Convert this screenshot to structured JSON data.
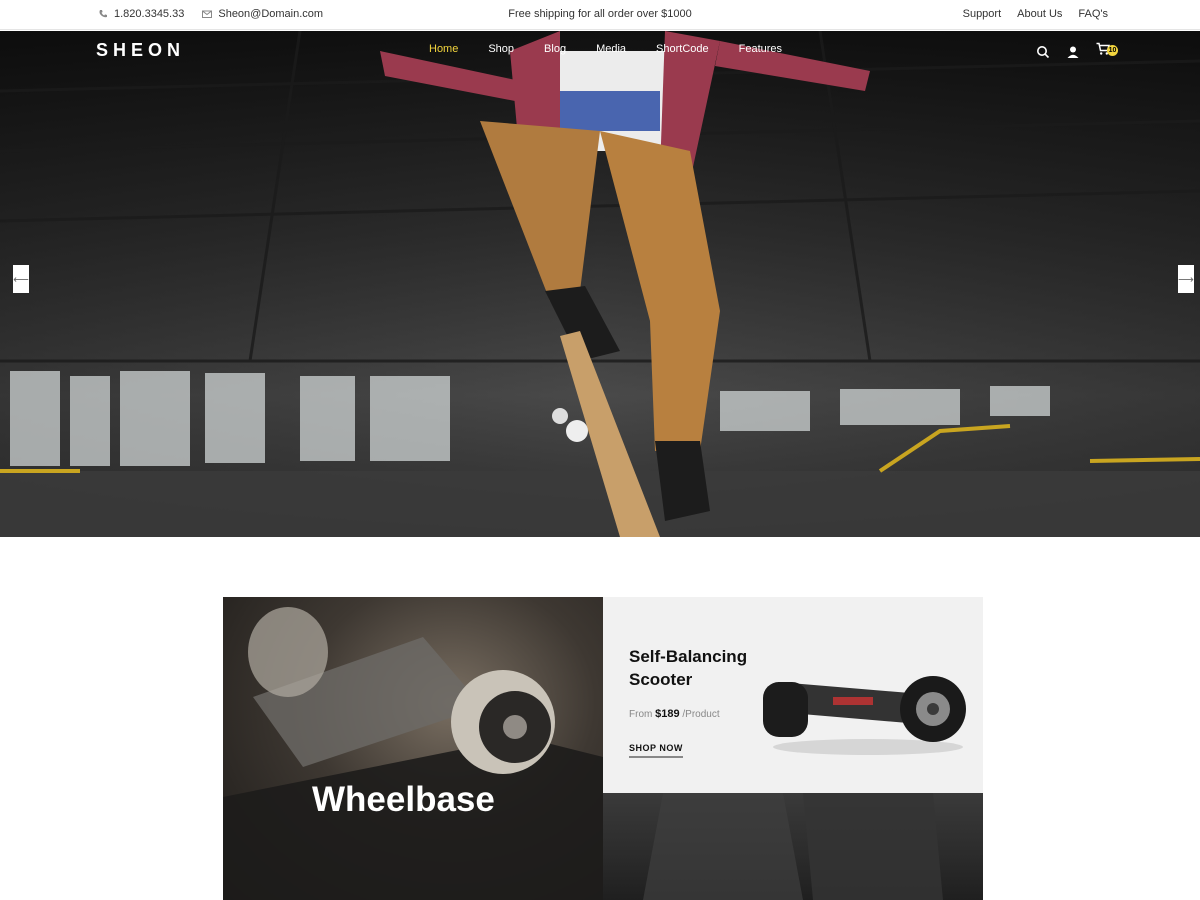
{
  "topbar": {
    "phone": "1.820.3345.33",
    "email": "Sheon@Domain.com",
    "shipping": "Free shipping for all order over $1000",
    "links": [
      "Support",
      "About Us",
      "FAQ's"
    ]
  },
  "header": {
    "logo": "SHEON",
    "menu": [
      "Home",
      "Shop",
      "Blog",
      "Media",
      "ShortCode",
      "Features"
    ],
    "active": "Home",
    "cart_count": "10",
    "icons": [
      "search-icon",
      "user-icon",
      "cart-icon"
    ]
  },
  "hero": {
    "prev_arrow": "⟵",
    "next_arrow": "⟶"
  },
  "banners": {
    "left_title": "Wheelbase",
    "product_title": "Self-Balancing Scooter",
    "price_prefix": "From",
    "price": "$189",
    "price_suffix": "/Product",
    "cta": "SHOP NOW"
  },
  "colors": {
    "accent": "#f2d43d",
    "text_dark": "#111111",
    "muted": "#888888"
  }
}
